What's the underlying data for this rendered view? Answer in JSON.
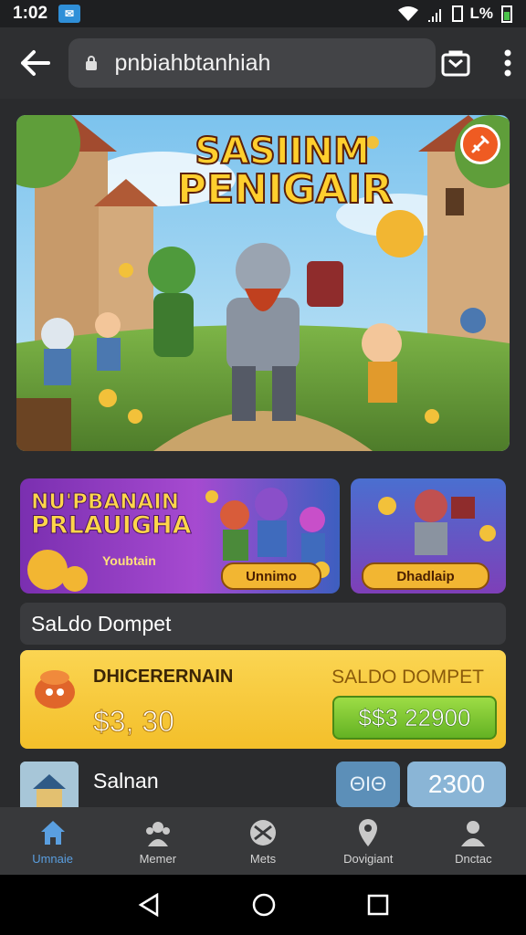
{
  "status_bar": {
    "time": "1:02",
    "right_text": "L%"
  },
  "browser": {
    "url": "pnbiahbtanhiah"
  },
  "hero": {
    "title_line1": "SASIINM",
    "title_line2": "PENIGAIR"
  },
  "promo1": {
    "title_line1": "NU'PBANAIN",
    "title_line2": "PRLAUIGHA",
    "subtitle": "Youbtain",
    "button": "Unnimo"
  },
  "promo2": {
    "button": "Dhadlaip"
  },
  "section": {
    "title": "SaLdo Dompet"
  },
  "wallet": {
    "label": "DHICERERNAIN",
    "right_label": "SALDO DOMPET",
    "amount": "$3, 30",
    "button": "$$3 22900"
  },
  "saldo_row": {
    "title": "Salnan",
    "chip1": "ΘΙΘ",
    "chip2": "2300"
  },
  "bottom_nav": [
    {
      "label": "Umnaie",
      "icon": "home-icon"
    },
    {
      "label": "Memer",
      "icon": "users-icon"
    },
    {
      "label": "Mets",
      "icon": "target-icon"
    },
    {
      "label": "Dovigiant",
      "icon": "pin-icon"
    },
    {
      "label": "Dnctac",
      "icon": "profile-icon"
    }
  ],
  "colors": {
    "accent": "#5a9fe0",
    "wallet": "#f7c838",
    "topup": "#7cc52f"
  }
}
